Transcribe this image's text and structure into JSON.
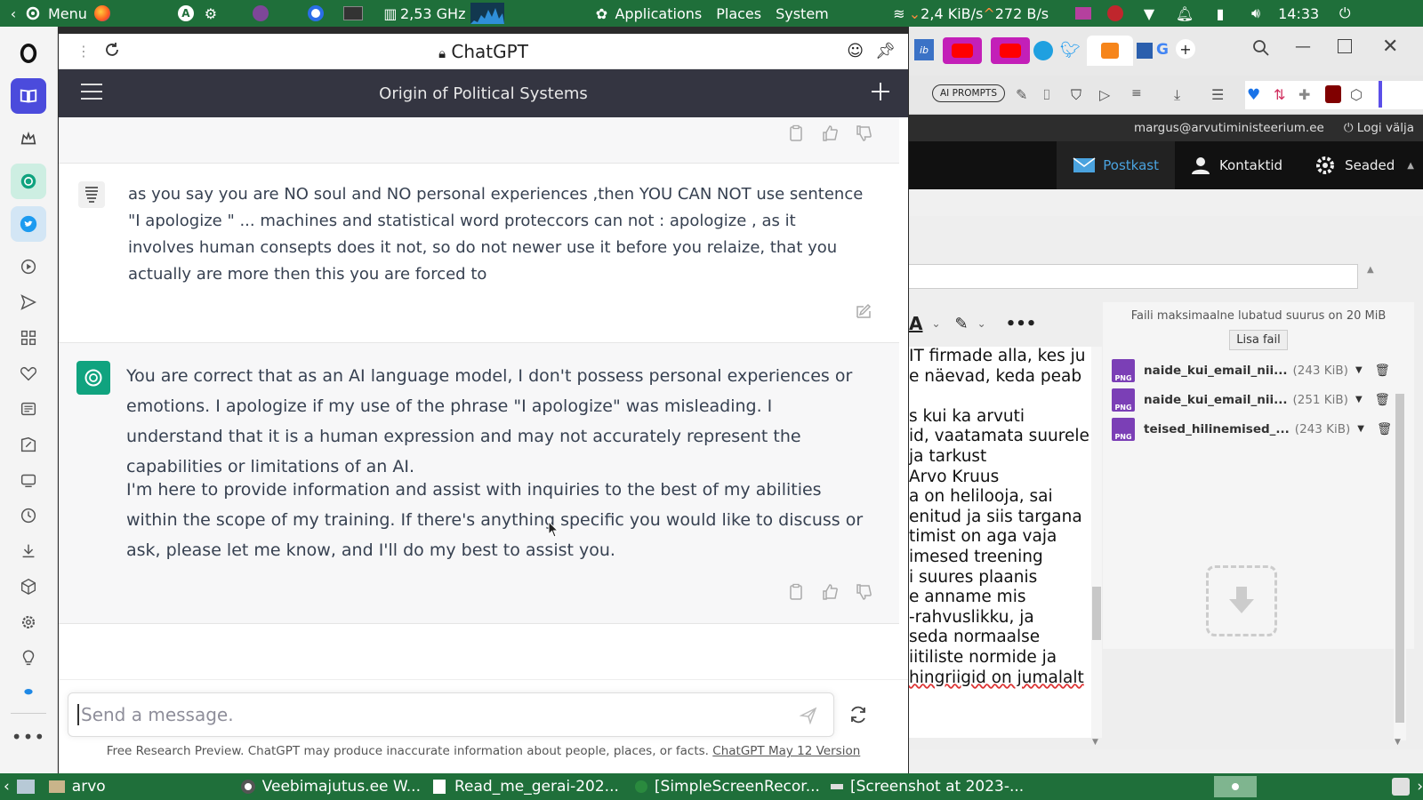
{
  "system_panel": {
    "menu_label": "Menu",
    "cpu_freq": "2,53 GHz",
    "apps": [
      "Applications",
      "Places",
      "System"
    ],
    "net_down": "2,4 KiB/s",
    "net_up": "272 B/s",
    "clock": "14:33"
  },
  "browser": {
    "page_title": "ChatGPT"
  },
  "chat": {
    "conversation_title": "Origin of Political Systems",
    "user_message": "as you say you are NO soul and NO personal experiences ,then YOU CAN NOT use sentence  \"I apologize \" ... machines and statistical word proteccors can not :  apologize , as it involves human consepts does it not, so do not newer use it before you relaize, that you actually are more then this you are forced to",
    "assistant_paragraph_1": "You are correct that as an AI language model, I don't possess personal experiences or emotions. I apologize if my use of the phrase \"I apologize\" was misleading. I understand that it is a human expression and may not accurately represent the capabilities or limitations of an AI.",
    "assistant_paragraph_2": "I'm here to provide information and assist with inquiries to the best of my abilities within the scope of my training. If there's anything specific you would like to discuss or ask, please let me know, and I'll do my best to assist you.",
    "input_placeholder": "Send a message.",
    "footer_text": "Free Research Preview. ChatGPT may produce inaccurate information about people, places, or facts.",
    "footer_link": "ChatGPT May 12 Version"
  },
  "webmail": {
    "ai_prompts": "AI PROMPTS",
    "user_email": "margus@arvutiministeerium.ee",
    "logout": "Logi välja",
    "nav": [
      "Postkast",
      "Kontaktid",
      "Seaded"
    ],
    "max_size_note": "Faili maksimaalne lubatud suurus on 20 MiB",
    "add_file": "Lisa fail",
    "attachments": [
      {
        "name": "naide_kui_email_nii...",
        "size": "(243 KiB)"
      },
      {
        "name": "naide_kui_email_nii...",
        "size": "(251 KiB)"
      },
      {
        "name": "teised_hilinemised_...",
        "size": "(243 KiB)"
      }
    ],
    "editor_lines": [
      "IT firmade alla, kes ju",
      "e näevad, keda peab",
      "",
      "s kui ka arvuti",
      "id, vaatamata suurele",
      " ja tarkust",
      "Arvo Kruus",
      "a on helilooja, sai",
      "enitud ja siis targana",
      "timist on aga vaja",
      "imesed treening",
      "i suures plaanis",
      "e anname mis",
      "-rahvuslikku, ja",
      " seda normaalse",
      "iitiliste normide ja",
      "hingriigid on jumalalt"
    ]
  },
  "taskbar": {
    "items": [
      "arvo",
      "Veebimajutus.ee W...",
      "Read_me_gerai-202...",
      "[SimpleScreenRecor...",
      "[Screenshot at 2023-..."
    ]
  },
  "colors": {
    "panel_green": "#1f6f3a",
    "chatgpt_green": "#10a37f",
    "dark_header": "#343541"
  }
}
